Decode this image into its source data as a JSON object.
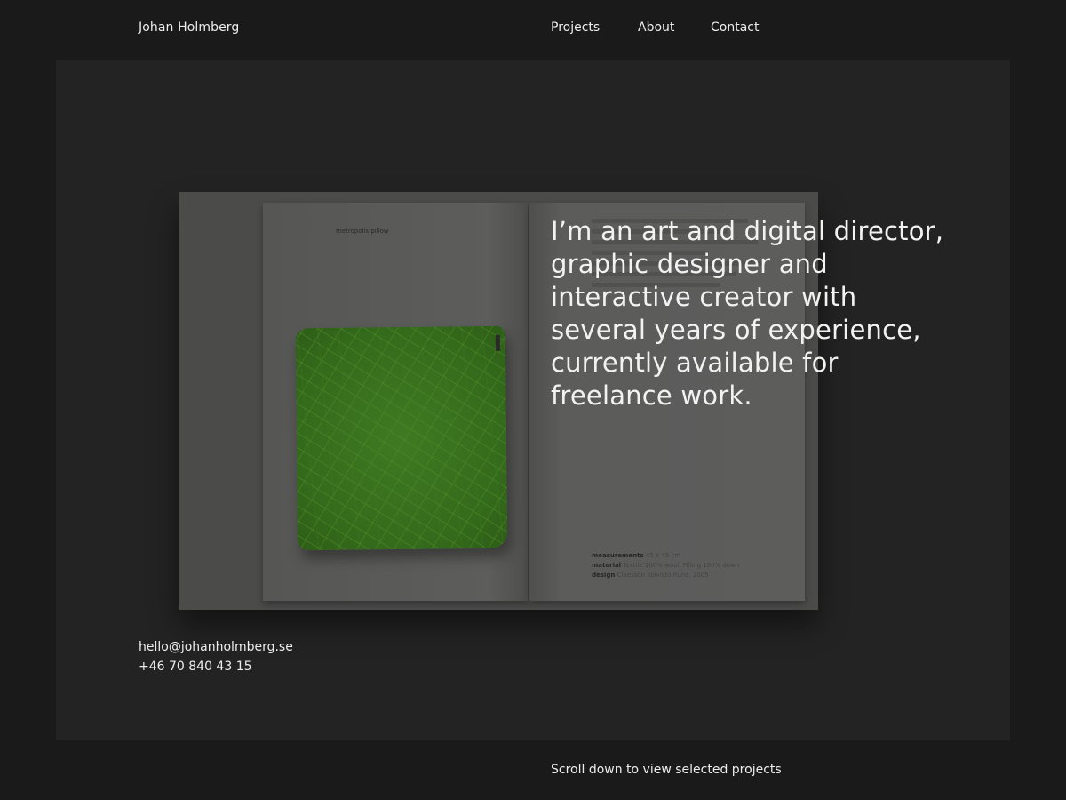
{
  "header": {
    "brand": "Johan Holmberg",
    "nav": [
      "Projects",
      "About",
      "Contact"
    ]
  },
  "hero": {
    "headline": "I’m an art and digital director, graphic designer and interactive creator with several years of experience, currently available for freelance work.",
    "booklet": {
      "left_page_caption": "metropolis pillow",
      "spec": [
        {
          "label": "measurements",
          "value": "45 x 45 cm"
        },
        {
          "label": "material",
          "value": "Textile 100% wool. Filling 100% down"
        },
        {
          "label": "design",
          "value": "Claesson Koivisto Rune, 2005"
        }
      ]
    }
  },
  "contact": {
    "email": "hello@johanholmberg.se",
    "phone": "+46 70 840 43 15"
  },
  "footer": {
    "scroll_hint": "Scroll down to view selected projects"
  },
  "colors": {
    "background": "#1a1a1a",
    "hero_panel": "#232323",
    "text": "#ededed",
    "pillow_green": "#3f7a22"
  }
}
